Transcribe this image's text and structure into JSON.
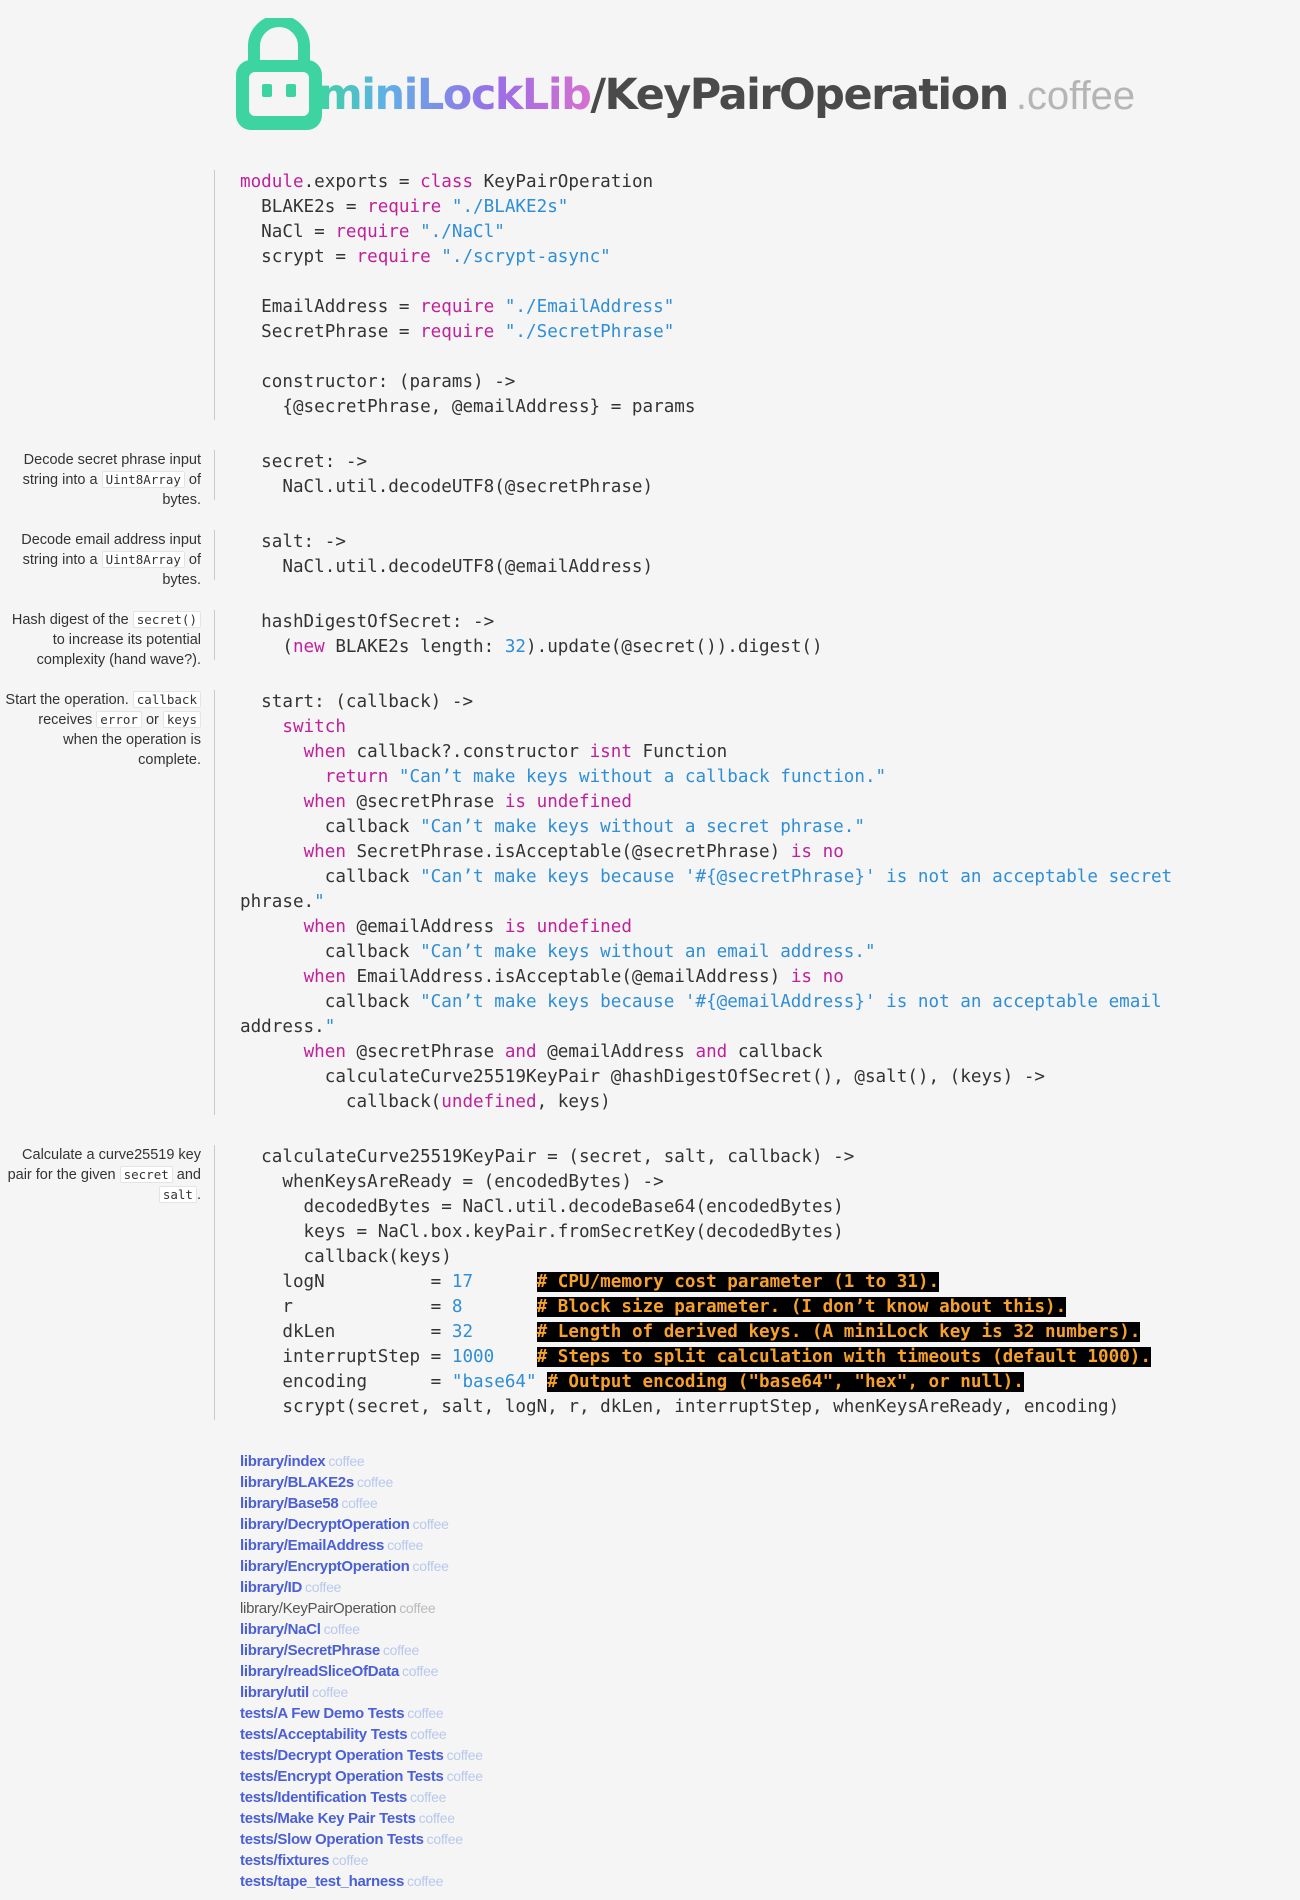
{
  "header": {
    "title_part1": "miniLockLib",
    "title_part2": "/KeyPairOperation",
    "title_ext": ".coffee"
  },
  "notes": {
    "secret": [
      "Decode secret phrase input string into a ",
      "Uint8Array",
      " of bytes."
    ],
    "salt": [
      "Decode email address input string into a ",
      "Uint8Array",
      " of bytes."
    ],
    "hash": [
      "Hash digest of the ",
      "secret()",
      " to increase its potential complexity (hand wave?)."
    ],
    "start": [
      "Start the operation. ",
      "callback",
      " receives ",
      "error",
      " or ",
      "keys",
      " when the operation is complete."
    ],
    "calc": [
      "Calculate a curve25519 key pair for the given ",
      "secret",
      " and ",
      "salt",
      "."
    ]
  },
  "code": {
    "s1": [
      "module.exports = class KeyPairOperation",
      "  BLAKE2s = require \"./BLAKE2s\"",
      "  NaCl = require \"./NaCl\"",
      "  scrypt = require \"./scrypt-async\"",
      "",
      "  EmailAddress = require \"./EmailAddress\"",
      "  SecretPhrase = require \"./SecretPhrase\"",
      "",
      "  constructor: (params) ->",
      "    {@secretPhrase, @emailAddress} = params"
    ],
    "s2": [
      "  secret: ->",
      "    NaCl.util.decodeUTF8(@secretPhrase)"
    ],
    "s3": [
      "  salt: ->",
      "    NaCl.util.decodeUTF8(@emailAddress)"
    ],
    "s4": [
      "  hashDigestOfSecret: ->",
      "    (new BLAKE2s length: 32).update(@secret()).digest()"
    ],
    "s5": [
      "  start: (callback) ->",
      "    switch",
      "      when callback?.constructor isnt Function",
      "        return \"Can’t make keys without a callback function.\"",
      "      when @secretPhrase is undefined",
      "        callback \"Can’t make keys without a secret phrase.\"",
      "      when SecretPhrase.isAcceptable(@secretPhrase) is no",
      "        callback \"Can’t make keys because '#{@secretPhrase}' is not an acceptable secret",
      "phrase.\"",
      "      when @emailAddress is undefined",
      "        callback \"Can’t make keys without an email address.\"",
      "      when EmailAddress.isAcceptable(@emailAddress) is no",
      "        callback \"Can’t make keys because '#{@emailAddress}' is not an acceptable email",
      "address.\"",
      "      when @secretPhrase and @emailAddress and callback",
      "        calculateCurve25519KeyPair @hashDigestOfSecret(), @salt(), (keys) ->",
      "          callback(undefined, keys)"
    ],
    "s6": [
      "  calculateCurve25519KeyPair = (secret, salt, callback) ->",
      "    whenKeysAreReady = (encodedBytes) ->",
      "      decodedBytes = NaCl.util.decodeBase64(encodedBytes)",
      "      keys = NaCl.box.keyPair.fromSecretKey(decodedBytes)",
      "      callback(keys)",
      "    logN          = 17      # CPU/memory cost parameter (1 to 31).",
      "    r             = 8       # Block size parameter. (I don’t know about this).",
      "    dkLen         = 32      # Length of derived keys. (A miniLock key is 32 numbers).",
      "    interruptStep = 1000    # Steps to split calculation with timeouts (default 1000).",
      "    encoding      = \"base64\" # Output encoding (\"base64\", \"hex\", or null).",
      "    scrypt(secret, salt, logN, r, dkLen, interruptStep, whenKeysAreReady, encoding)"
    ]
  },
  "files": [
    {
      "name": "library/index",
      "ext": "coffee"
    },
    {
      "name": "library/BLAKE2s",
      "ext": "coffee"
    },
    {
      "name": "library/Base58",
      "ext": "coffee"
    },
    {
      "name": "library/DecryptOperation",
      "ext": "coffee"
    },
    {
      "name": "library/EmailAddress",
      "ext": "coffee"
    },
    {
      "name": "library/EncryptOperation",
      "ext": "coffee"
    },
    {
      "name": "library/ID",
      "ext": "coffee"
    },
    {
      "name": "library/KeyPairOperation",
      "ext": "coffee",
      "current": true
    },
    {
      "name": "library/NaCl",
      "ext": "coffee"
    },
    {
      "name": "library/SecretPhrase",
      "ext": "coffee"
    },
    {
      "name": "library/readSliceOfData",
      "ext": "coffee"
    },
    {
      "name": "library/util",
      "ext": "coffee"
    },
    {
      "name": "tests/A Few Demo Tests",
      "ext": "coffee"
    },
    {
      "name": "tests/Acceptability Tests",
      "ext": "coffee"
    },
    {
      "name": "tests/Decrypt Operation Tests",
      "ext": "coffee"
    },
    {
      "name": "tests/Encrypt Operation Tests",
      "ext": "coffee"
    },
    {
      "name": "tests/Identification Tests",
      "ext": "coffee"
    },
    {
      "name": "tests/Make Key Pair Tests",
      "ext": "coffee"
    },
    {
      "name": "tests/Slow Operation Tests",
      "ext": "coffee"
    },
    {
      "name": "tests/fixtures",
      "ext": "coffee"
    },
    {
      "name": "tests/tape_test_harness",
      "ext": "coffee"
    }
  ]
}
